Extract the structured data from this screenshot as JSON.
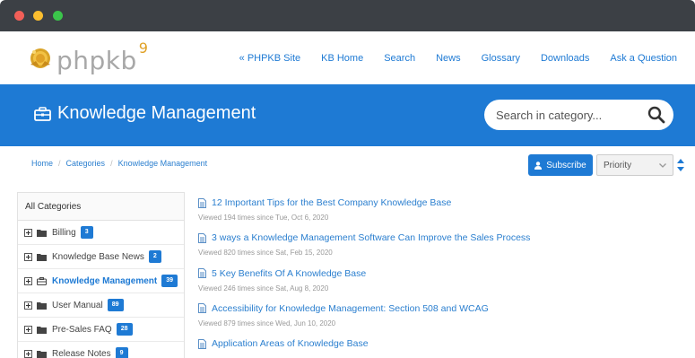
{
  "brand": {
    "logo_text": "phpkb",
    "logo_version": "9"
  },
  "topnav": {
    "items": [
      "« PHPKB Site",
      "KB Home",
      "Search",
      "News",
      "Glossary",
      "Downloads",
      "Ask a Question"
    ]
  },
  "banner": {
    "title": "Knowledge Management",
    "icon": "briefcase-icon",
    "search_placeholder": "Search in category..."
  },
  "breadcrumb": {
    "items": [
      "Home",
      "Categories",
      "Knowledge Management"
    ],
    "separator": "/"
  },
  "toolbar": {
    "subscribe_label": "Subscribe",
    "sort_value": "Priority"
  },
  "sidebar": {
    "heading": "All Categories",
    "items": [
      {
        "label": "Billing",
        "count": "3",
        "icon": "folder-icon"
      },
      {
        "label": "Knowledge Base News",
        "count": "2",
        "icon": "folder-icon"
      },
      {
        "label": "Knowledge Management",
        "count": "39",
        "icon": "briefcase-icon"
      },
      {
        "label": "User Manual",
        "count": "89",
        "icon": "folder-icon"
      },
      {
        "label": "Pre-Sales FAQ",
        "count": "28",
        "icon": "folder-icon"
      },
      {
        "label": "Release Notes",
        "count": "9",
        "icon": "folder-icon"
      }
    ]
  },
  "articles": [
    {
      "title": "12 Important Tips for the Best Company Knowledge Base",
      "meta": "Viewed 194 times since Tue, Oct 6, 2020"
    },
    {
      "title": "3 ways a Knowledge Management Software Can Improve the Sales Process",
      "meta": "Viewed 820 times since Sat, Feb 15, 2020"
    },
    {
      "title": "5 Key Benefits Of A Knowledge Base",
      "meta": "Viewed 246 times since Sat, Aug 8, 2020"
    },
    {
      "title": "Accessibility for Knowledge Management: Section 508 and WCAG",
      "meta": "Viewed 879 times since Wed, Jun 10, 2020"
    },
    {
      "title": "Application Areas of Knowledge Base",
      "meta": ""
    }
  ],
  "colors": {
    "accent": "#1e7ad4",
    "chrome": "#3c4045",
    "link": "#2b7fcf"
  }
}
